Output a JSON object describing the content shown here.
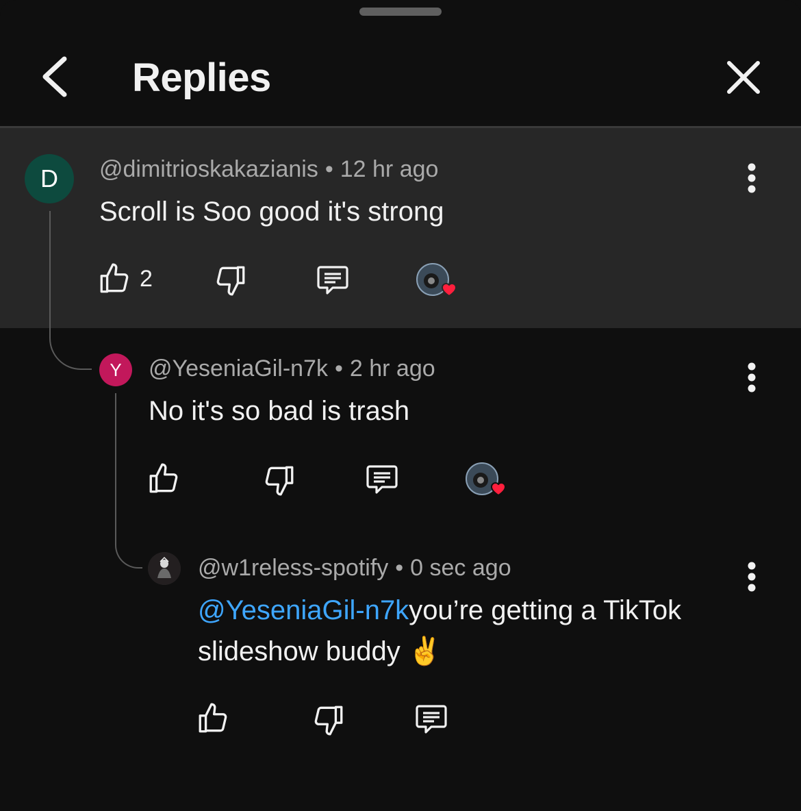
{
  "header": {
    "title": "Replies"
  },
  "comments": [
    {
      "avatar_letter": "D",
      "avatar_color": "#0d4a3e",
      "author": "@dimitrioskakazianis",
      "time": "12 hr ago",
      "text": "Scroll is Soo good it's strong",
      "like_count": "2"
    },
    {
      "avatar_letter": "Y",
      "avatar_color": "#c2185b",
      "author": "@YeseniaGil-n7k",
      "time": "2 hr ago",
      "text": "No it's so bad is trash"
    },
    {
      "author": "@w1reless-spotify",
      "time": "0 sec ago",
      "mention": "@YeseniaGil-n7k",
      "text": "you’re getting a TikTok",
      "text_line2": "slideshow buddy ✌️"
    }
  ],
  "colors": {
    "mention": "#3ea6ff",
    "heart": "#ff1f3d",
    "highlight_bg": "#272727"
  },
  "icons": [
    "back-icon",
    "close-icon",
    "thumb-up-icon",
    "thumb-down-icon",
    "reply-icon",
    "more-vert-icon",
    "creator-heart-icon"
  ]
}
